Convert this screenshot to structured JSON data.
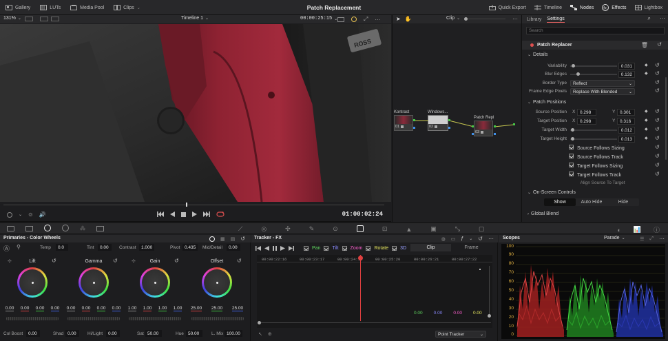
{
  "topbar": {
    "title": "Patch Replacement",
    "left": [
      {
        "label": "Gallery",
        "icon": "gallery-icon"
      },
      {
        "label": "LUTs",
        "icon": "luts-icon"
      },
      {
        "label": "Media Pool",
        "icon": "media-pool-icon"
      },
      {
        "label": "Clips",
        "icon": "clips-icon"
      }
    ],
    "right": [
      {
        "label": "Quick Export",
        "icon": "export-icon"
      },
      {
        "label": "Timeline",
        "icon": "timeline-icon"
      },
      {
        "label": "Nodes",
        "icon": "nodes-icon"
      },
      {
        "label": "Effects",
        "icon": "effects-icon"
      },
      {
        "label": "Lightbox",
        "icon": "lightbox-icon"
      }
    ]
  },
  "viewer": {
    "zoom": "131%",
    "timeline_name": "Timeline 1",
    "timecode_top": "00:00:25:15",
    "timecode": "01:00:02:24",
    "scrub_position": 0.48,
    "patch_text": "ROSS"
  },
  "node_editor": {
    "mode": "Clip",
    "nodes": [
      {
        "label": "Kontrast",
        "num": "01"
      },
      {
        "label": "Windows...",
        "num": "02"
      },
      {
        "label": "Patch Repl",
        "num": "03"
      }
    ]
  },
  "inspector": {
    "tabs": [
      "Library",
      "Settings"
    ],
    "active_tab": "Settings",
    "search_placeholder": "Search",
    "effect_name": "Patch Replacer",
    "details_title": "Details",
    "variability": {
      "label": "Variability",
      "value": "0.031",
      "level": 0.03
    },
    "blur_edges": {
      "label": "Blur Edges",
      "value": "0.132",
      "level": 0.13
    },
    "border_type": {
      "label": "Border Type",
      "value": "Reflect"
    },
    "frame_edge": {
      "label": "Frame Edge Pixels",
      "value": "Replace With Blended"
    },
    "patch_positions_title": "Patch Positions",
    "source_position": {
      "label": "Source Position",
      "x": "0.298",
      "y": "0.301"
    },
    "target_position": {
      "label": "Target Position",
      "x": "0.298",
      "y": "0.316"
    },
    "target_width": {
      "label": "Target Width",
      "value": "0.012",
      "level": 0.01
    },
    "target_height": {
      "label": "Target Height",
      "value": "0.013",
      "level": 0.01
    },
    "x_label": "X",
    "y_label": "Y",
    "checkboxes": [
      {
        "label": "Source Follows Sizing",
        "checked": true
      },
      {
        "label": "Source Follows Track",
        "checked": true
      },
      {
        "label": "Target Follows Sizing",
        "checked": true
      },
      {
        "label": "Target Follows Track",
        "checked": true
      }
    ],
    "align_button": "Align Source To Target",
    "onscreen_title": "On-Screen Controls",
    "onscreen_options": [
      "Show",
      "Auto Hide",
      "Hide"
    ],
    "onscreen_selected": "Show",
    "global_blend_title": "Global Blend"
  },
  "primaries": {
    "title": "Primaries - Color Wheels",
    "temp_label": "Temp",
    "temp": "0.0",
    "tint_label": "Tint",
    "tint": "0.00",
    "contrast_label": "Contrast",
    "contrast": "1.000",
    "pivot_label": "Pivot",
    "pivot": "0.435",
    "middetail_label": "Mid/Detail",
    "middetail": "0.00",
    "wheels": [
      {
        "name": "Lift",
        "values": [
          "0.00",
          "0.00",
          "0.00",
          "0.00"
        ]
      },
      {
        "name": "Gamma",
        "values": [
          "0.00",
          "0.00",
          "0.00",
          "0.00"
        ]
      },
      {
        "name": "Gain",
        "values": [
          "1.00",
          "1.00",
          "1.00",
          "1.00"
        ]
      },
      {
        "name": "Offset",
        "values": [
          "25.00",
          "25.00",
          "25.00"
        ]
      }
    ],
    "bottom": [
      {
        "label": "Col Boost",
        "value": "0.00"
      },
      {
        "label": "Shad",
        "value": "0.00"
      },
      {
        "label": "Hi/Light",
        "value": "0.00"
      },
      {
        "label": "Sat",
        "value": "50.00"
      },
      {
        "label": "Hue",
        "value": "50.00"
      },
      {
        "label": "L. Mix",
        "value": "100.00"
      }
    ]
  },
  "tracker": {
    "title": "Tracker - FX",
    "options": [
      {
        "label": "Pan",
        "color": "#5fd35f"
      },
      {
        "label": "Tilt",
        "color": "#8a8aff"
      },
      {
        "label": "Zoom",
        "color": "#ff5fd0"
      },
      {
        "label": "Rotate",
        "color": "#e6e65f"
      },
      {
        "label": "3D",
        "color": "#9aa0ff"
      }
    ],
    "modes": [
      "Clip",
      "Frame"
    ],
    "active_mode": "Clip",
    "ruler": [
      "00:00:22:16",
      "00:00:23:17",
      "00:00:24:18",
      "00:00:25:20",
      "00:00:26:21",
      "00:00:27:22"
    ],
    "playhead_position": 0.44,
    "readouts": [
      {
        "value": "0.00",
        "color": "#5fd35f"
      },
      {
        "value": "0.00",
        "color": "#8a8aff"
      },
      {
        "value": "0.00",
        "color": "#ff5fd0"
      },
      {
        "value": "0.00",
        "color": "#e6e65f"
      }
    ],
    "dropdown": "Point Tracker"
  },
  "scopes": {
    "title": "Scopes",
    "mode": "Parade",
    "scale": [
      "100",
      "90",
      "80",
      "70",
      "60",
      "50",
      "40",
      "30",
      "20",
      "10",
      "0"
    ]
  }
}
